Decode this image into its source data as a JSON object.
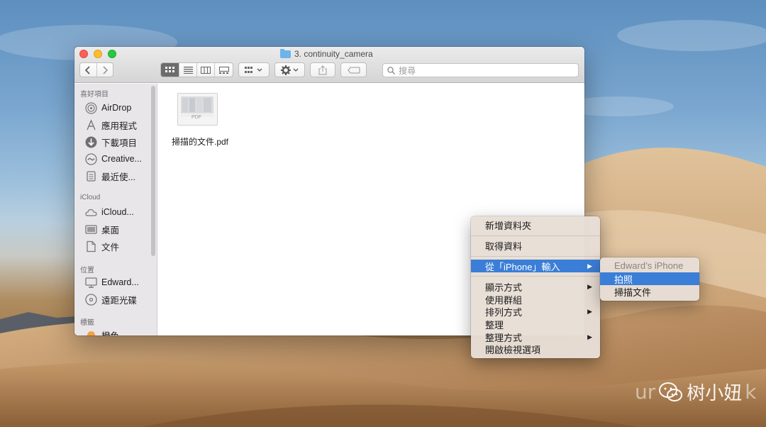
{
  "window": {
    "title": "3. continuity_camera",
    "search_placeholder": "搜尋"
  },
  "sidebar": {
    "sections": [
      {
        "heading": "喜好項目",
        "items": [
          "AirDrop",
          "應用程式",
          "下載項目",
          "Creative...",
          "最近使..."
        ]
      },
      {
        "heading": "iCloud",
        "items": [
          "iCloud...",
          "桌面",
          "文件"
        ]
      },
      {
        "heading": "位置",
        "items": [
          "Edward...",
          "遠距光碟"
        ]
      },
      {
        "heading": "標籤",
        "items": [
          "橙色"
        ]
      }
    ]
  },
  "files": [
    {
      "name": "掃描的文件.pdf",
      "thumb_label": "PDF"
    }
  ],
  "context_menu": {
    "items": [
      "新增資料夾",
      "取得資料",
      "從「iPhone」輸入",
      "顯示方式",
      "使用群組",
      "排列方式",
      "整理",
      "整理方式",
      "開啟檢視選項"
    ],
    "highlighted": "從「iPhone」輸入",
    "submenu_arrows": [
      "從「iPhone」輸入",
      "顯示方式",
      "排列方式",
      "整理方式"
    ]
  },
  "submenu": {
    "device": "Edward’s iPhone",
    "items": [
      "拍照",
      "掃描文件"
    ],
    "highlighted": "拍照"
  },
  "watermark": {
    "text": "树小妞",
    "bg_text": "ur",
    "bg_text_end": "k"
  },
  "colors": {
    "menu_highlight": "#3b7ed7",
    "close": "#fc5f57",
    "minimize": "#fdbc2e",
    "zoom": "#29c841"
  }
}
